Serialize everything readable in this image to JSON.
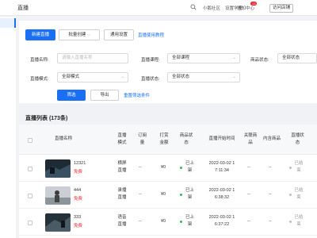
{
  "topbar": {
    "title": "直播",
    "nav": [
      "小鹅社区",
      "设置学堂",
      "通知中心",
      "访问店铺"
    ],
    "notify_badge": "13"
  },
  "toolbar": {
    "new_live": "新建直播",
    "batch_create": "批量创建",
    "general_settings": "通用设置",
    "tutorial_link": "直播使用教程"
  },
  "filters": {
    "name_label": "直播名称:",
    "name_placeholder": "请输入直播名称",
    "course_label": "直播课程:",
    "course_value": "全部课程",
    "product_status_label": "商品状态:",
    "product_status_value": "全部状态",
    "mode_label": "直播模式:",
    "mode_value": "全部模式",
    "live_status_label": "直播状态:",
    "live_status_value": "全部状态",
    "filter_btn": "筛选",
    "export_btn": "导出",
    "reset_link": "重置筛选条件"
  },
  "list": {
    "title": "直播列表 (173条)",
    "columns": [
      "直播名称",
      "直播模式",
      "订阅量",
      "打赏金额",
      "商品状态",
      "直播开始时间",
      "关联商品",
      "内含商品",
      "直播状态"
    ],
    "rows": [
      {
        "name": "12321",
        "price": "免费",
        "mode": "横屏直播",
        "subs": "--",
        "reward": "¥0",
        "product_status": "已上架",
        "start_date": "2022-03-02 1",
        "start_time": "7:11:34",
        "linked": "--",
        "contained": "--",
        "status": "已结束"
      },
      {
        "name": "444",
        "price": "免费",
        "mode": "录播直播",
        "subs": "--",
        "reward": "¥0",
        "product_status": "已上架",
        "start_date": "2022-03-02 1",
        "start_time": "6:38:32",
        "linked": "--",
        "contained": "--",
        "status": "已结束"
      },
      {
        "name": "333",
        "price": "免费",
        "mode": "语音直播",
        "subs": "--",
        "reward": "¥0",
        "product_status": "已上架",
        "start_date": "2022-03-02 1",
        "start_time": "6:37:22",
        "linked": "--",
        "contained": "--",
        "status": "已结束"
      }
    ]
  },
  "colors": {
    "primary": "#1a6ff5",
    "free": "#f5222d",
    "published_dot": "#2bbc5d",
    "ended_dot": "#bfbfbf"
  },
  "icons": [
    "search-icon",
    "chevron-down-icon",
    "checkbox-icon"
  ]
}
